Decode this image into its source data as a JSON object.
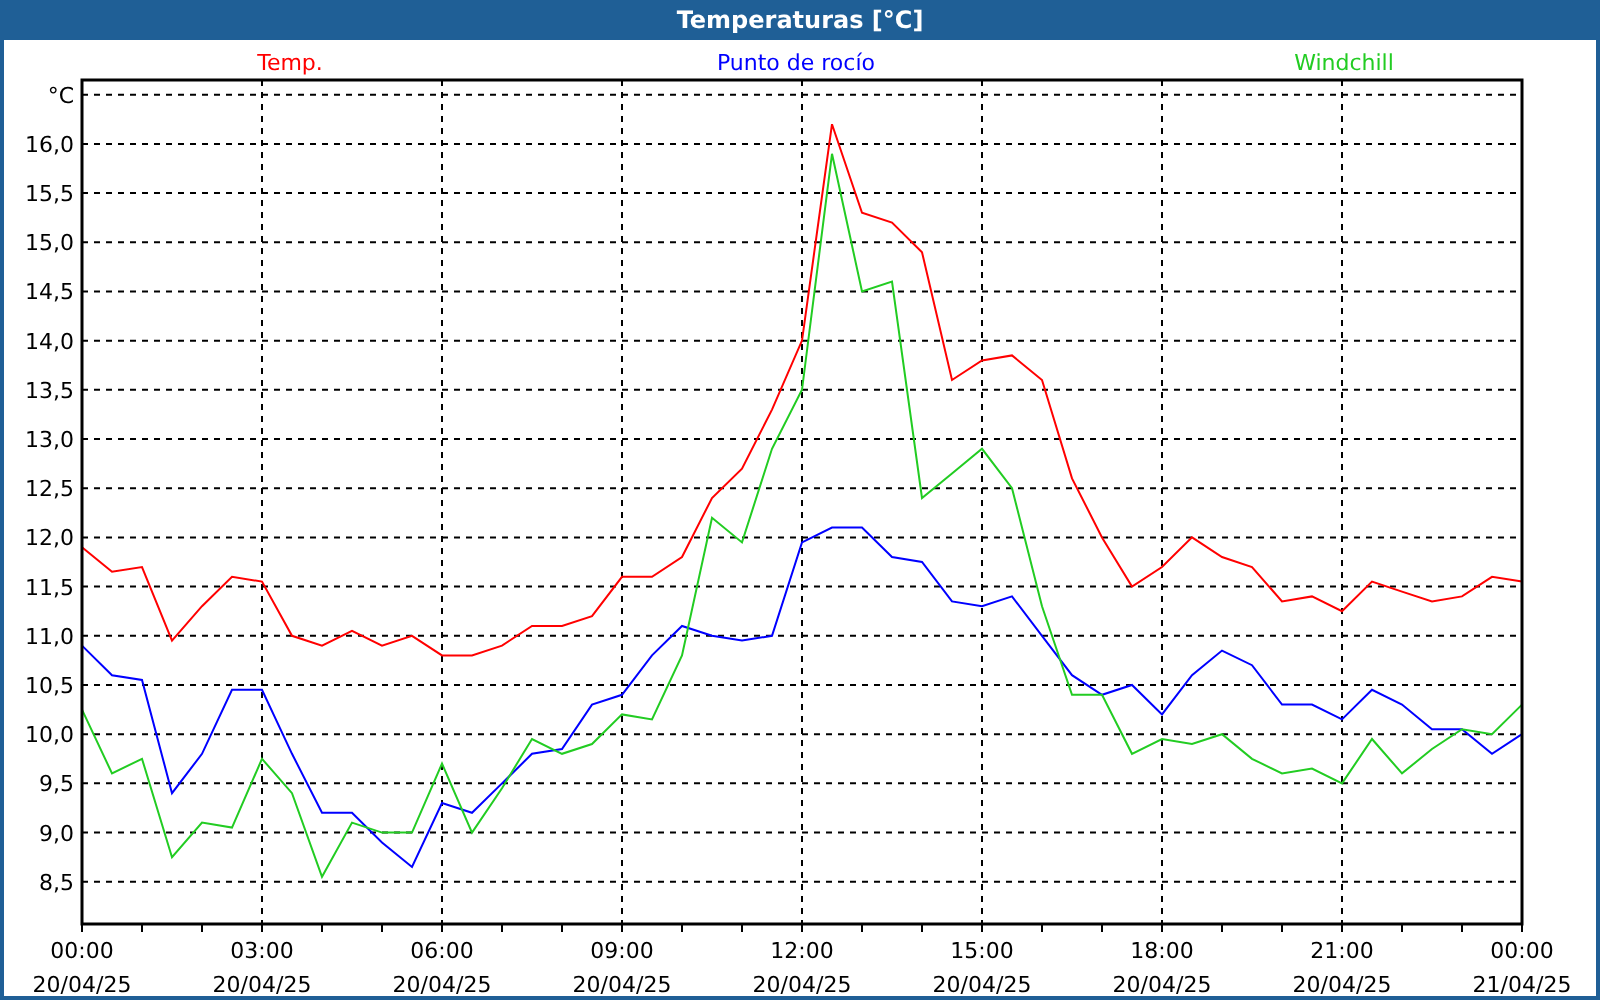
{
  "chart": {
    "chart_data": {
      "type": "line",
      "title": "Temperaturas [°C]",
      "categories": [
        "00:00 20/04/25",
        null,
        null,
        null,
        null,
        null,
        "03:00 20/04/25",
        null,
        null,
        null,
        null,
        null,
        "06:00 20/04/25",
        null,
        null,
        null,
        null,
        null,
        "09:00 20/04/25",
        null,
        null,
        null,
        null,
        null,
        "12:00 20/04/25",
        null,
        null,
        null,
        null,
        null,
        "15:00 20/04/25",
        null,
        null,
        null,
        null,
        null,
        "18:00 20/04/25",
        null,
        null,
        null,
        null,
        null,
        "21:00 20/04/25",
        null,
        null,
        null,
        null,
        null,
        "00:00 21/04/25"
      ],
      "series": [
        {
          "name": "Temp.",
          "color": "#ff0000",
          "values": [
            11.9,
            11.65,
            11.7,
            10.95,
            11.3,
            11.6,
            11.55,
            11.0,
            10.9,
            11.05,
            10.9,
            11.0,
            10.8,
            10.8,
            10.9,
            11.1,
            11.1,
            11.2,
            11.6,
            11.6,
            11.8,
            12.4,
            12.7,
            13.3,
            14.0,
            16.2,
            15.3,
            15.2,
            14.9,
            13.6,
            13.8,
            13.85,
            13.6,
            12.6,
            12.0,
            11.5,
            11.7,
            12.0,
            11.8,
            11.7,
            11.35,
            11.4,
            11.25,
            11.55,
            11.45,
            11.35,
            11.4,
            11.6,
            11.55
          ]
        },
        {
          "name": "Punto de rocío",
          "color": "#0000ff",
          "values": [
            10.9,
            10.6,
            10.55,
            9.4,
            9.8,
            10.45,
            10.45,
            9.8,
            9.2,
            9.2,
            8.9,
            8.65,
            9.3,
            9.2,
            9.5,
            9.8,
            9.85,
            10.3,
            10.4,
            10.8,
            11.1,
            11.0,
            10.95,
            11.0,
            11.95,
            12.1,
            12.1,
            11.8,
            11.75,
            11.35,
            11.3,
            11.4,
            11.0,
            10.6,
            10.4,
            10.5,
            10.2,
            10.6,
            10.85,
            10.7,
            10.3,
            10.3,
            10.15,
            10.45,
            10.3,
            10.05,
            10.05,
            9.8,
            10.0
          ]
        },
        {
          "name": "Windchill",
          "color": "#22cc22",
          "values": [
            10.25,
            9.6,
            9.75,
            8.75,
            9.1,
            9.05,
            9.75,
            9.4,
            8.55,
            9.1,
            9.0,
            9.0,
            9.7,
            9.0,
            9.45,
            9.95,
            9.8,
            9.9,
            10.2,
            10.15,
            10.8,
            12.2,
            11.95,
            12.9,
            13.5,
            15.9,
            14.5,
            14.6,
            12.4,
            12.65,
            12.9,
            12.5,
            11.3,
            10.4,
            10.4,
            9.8,
            9.95,
            9.9,
            10.0,
            9.75,
            9.6,
            9.65,
            9.5,
            9.95,
            9.6,
            9.85,
            10.05,
            10.0,
            10.3
          ]
        }
      ],
      "grid": true,
      "ylim": [
        8.07,
        16.65
      ],
      "yticks": [
        {
          "value": 8.5,
          "label": "8,5"
        },
        {
          "value": 9,
          "label": "9,0"
        },
        {
          "value": 9.5,
          "label": "9,5"
        },
        {
          "value": 10,
          "label": "10,0"
        },
        {
          "value": 10.5,
          "label": "10,5"
        },
        {
          "value": 11,
          "label": "11,0"
        },
        {
          "value": 11.5,
          "label": "11,5"
        },
        {
          "value": 12,
          "label": "12,0"
        },
        {
          "value": 12.5,
          "label": "12,5"
        },
        {
          "value": 13,
          "label": "13,0"
        },
        {
          "value": 13.5,
          "label": "13,5"
        },
        {
          "value": 14,
          "label": "14,0"
        },
        {
          "value": 14.5,
          "label": "14,5"
        },
        {
          "value": 15,
          "label": "15,0"
        },
        {
          "value": 15.5,
          "label": "15,5"
        },
        {
          "value": 16,
          "label": "16,0"
        },
        {
          "value": 16.5,
          "label": "°C"
        }
      ]
    }
  }
}
